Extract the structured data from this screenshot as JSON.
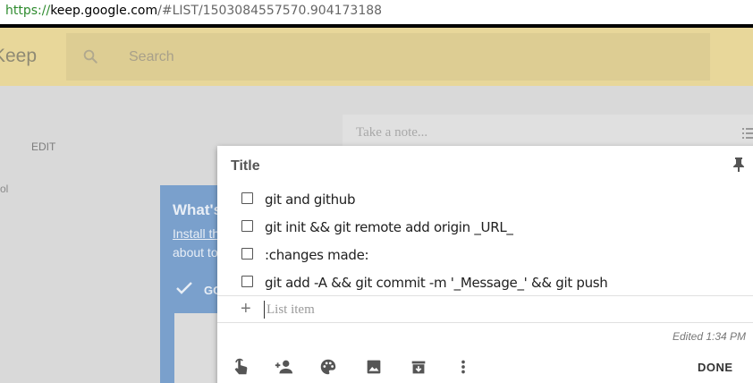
{
  "browser": {
    "url_scheme": "https://",
    "url_host": "keep.google.com",
    "url_path": "/#LIST/1503084557570.904173188"
  },
  "app": {
    "logo_text": "Keep",
    "search_placeholder": "Search",
    "sidebar_edit_label": "EDIT",
    "sidebar_fragment": "ol",
    "take_note_placeholder": "Take a note...",
    "promo": {
      "title": "What's",
      "link_text": "Install th",
      "line2": "about to",
      "action_label": "GO"
    },
    "colors": {
      "header_yellow": "#e8d79a",
      "promo_blue": "#7aa0cc"
    }
  },
  "note": {
    "title_placeholder": "Title",
    "items": [
      {
        "text": "git and github",
        "checked": false
      },
      {
        "text": "git init && git remote add origin _URL_",
        "checked": false
      },
      {
        "text": ":changes made:",
        "checked": false
      },
      {
        "text": "git add -A && git commit -m '_Message_' && git push",
        "checked": false
      }
    ],
    "add_item_symbol": "+",
    "list_item_placeholder": "List item",
    "edited_text": "Edited 1:34 PM",
    "done_label": "DONE",
    "toolbar_icons": [
      "reminder-icon",
      "collaborator-icon",
      "palette-icon",
      "image-icon",
      "archive-icon",
      "more-icon"
    ]
  }
}
